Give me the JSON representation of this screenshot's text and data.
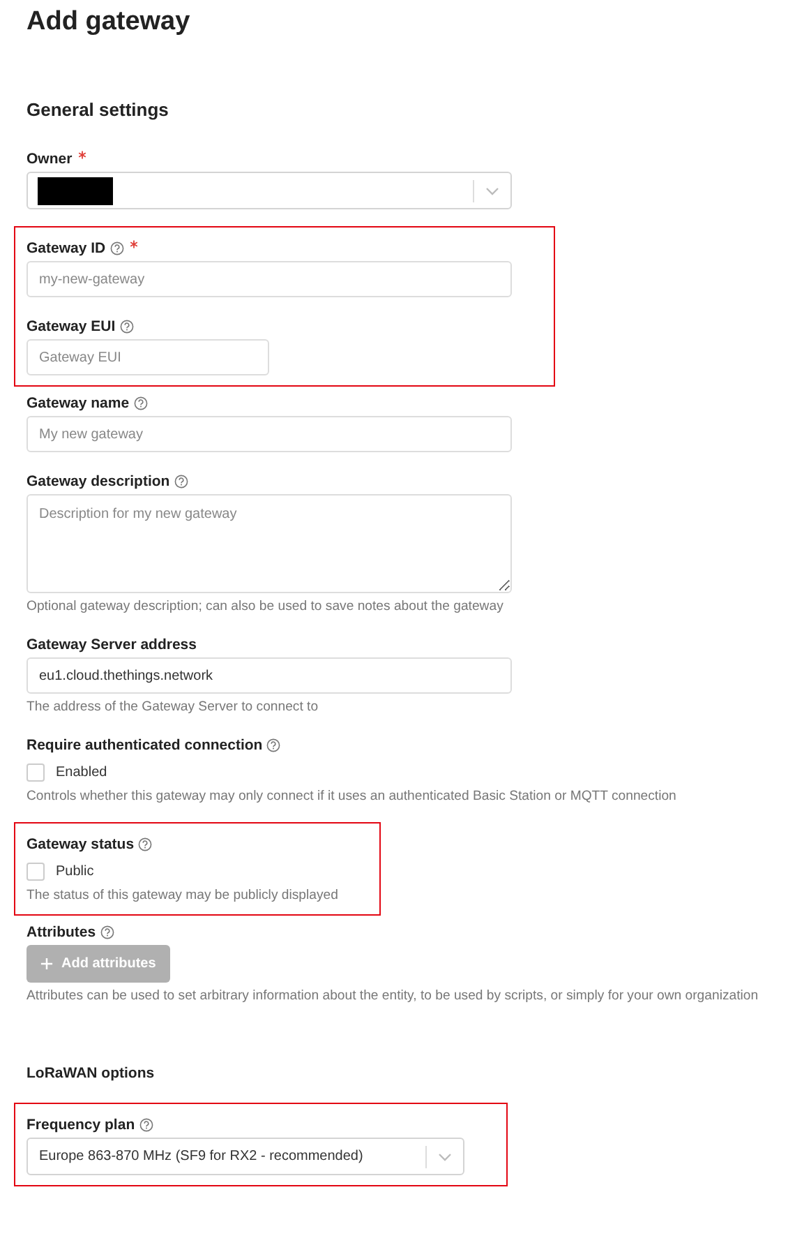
{
  "page_title": "Add gateway",
  "sections": [
    {
      "title": "General settings",
      "items": [
        {
          "kind": "select",
          "label": "Owner",
          "required": true,
          "help": false,
          "redacted": true
        },
        {
          "kind": "frame",
          "fields": [
            {
              "kind": "input",
              "label": "Gateway ID",
              "required": true,
              "help": true,
              "placeholder": "my-new-gateway"
            },
            {
              "kind": "input",
              "label": "Gateway EUI",
              "required": false,
              "help": true,
              "placeholder": "Gateway EUI",
              "narrow": true
            }
          ]
        },
        {
          "kind": "input",
          "label": "Gateway name",
          "required": false,
          "help": true,
          "placeholder": "My new gateway"
        },
        {
          "kind": "textarea",
          "label": "Gateway description",
          "required": false,
          "help": true,
          "placeholder": "Description for my new gateway",
          "description": "Optional gateway description; can also be used to save notes about the gateway"
        },
        {
          "kind": "input",
          "label": "Gateway Server address",
          "required": false,
          "help": false,
          "value": "eu1.cloud.thethings.network",
          "description": "The address of the Gateway Server to connect to"
        },
        {
          "kind": "checkbox",
          "label": "Require authenticated connection",
          "required": false,
          "help": true,
          "option": "Enabled",
          "checked": false,
          "description": "Controls whether this gateway may only connect if it uses an authenticated Basic Station or MQTT connection"
        },
        {
          "kind": "frame",
          "fields": [
            {
              "kind": "checkbox",
              "label": "Gateway status",
              "required": false,
              "help": true,
              "option": "Public",
              "checked": false,
              "description": "The status of this gateway may be publicly displayed"
            }
          ]
        },
        {
          "kind": "button",
          "label": "Attributes",
          "required": false,
          "help": true,
          "button": "Add attributes",
          "disabled": true,
          "description": "Attributes can be used to set arbitrary information about the entity, to be used by scripts, or simply for your own organization"
        }
      ]
    },
    {
      "title": "LoRaWAN options",
      "items": [
        {
          "kind": "frame",
          "fields": [
            {
              "kind": "select",
              "label": "Frequency plan",
              "required": false,
              "help": true,
              "value": "Europe 863-870 MHz (SF9 for RX2 - recommended)"
            }
          ]
        }
      ]
    }
  ]
}
